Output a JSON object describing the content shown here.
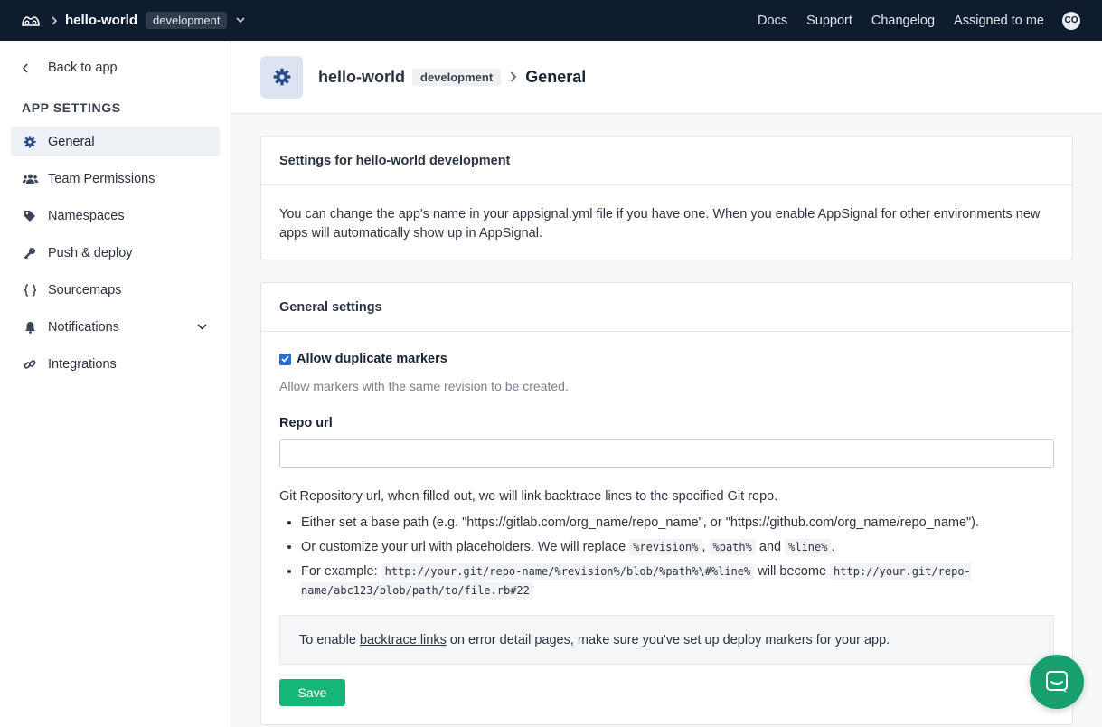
{
  "topbar": {
    "app_name": "hello-world",
    "environment": "development",
    "nav": [
      "Docs",
      "Support",
      "Changelog",
      "Assigned to me"
    ],
    "avatar_initials": "CO"
  },
  "sidebar": {
    "back_label": "Back to app",
    "section_title": "APP SETTINGS",
    "items": [
      {
        "label": "General",
        "icon": "gear-icon",
        "active": true
      },
      {
        "label": "Team Permissions",
        "icon": "users-icon"
      },
      {
        "label": "Namespaces",
        "icon": "tag-icon"
      },
      {
        "label": "Push & deploy",
        "icon": "key-icon"
      },
      {
        "label": "Sourcemaps",
        "icon": "braces-icon"
      },
      {
        "label": "Notifications",
        "icon": "bell-icon",
        "expandable": true
      },
      {
        "label": "Integrations",
        "icon": "link-icon"
      }
    ]
  },
  "header": {
    "app_name": "hello-world",
    "environment": "development",
    "title": "General"
  },
  "settings_card": {
    "title": "Settings for hello-world development",
    "body": "You can change the app's name in your appsignal.yml file if you have one. When you enable AppSignal for other environments new apps will automatically show up in AppSignal."
  },
  "general_card": {
    "title": "General settings",
    "duplicate_markers": {
      "label": "Allow duplicate markers",
      "checked": true,
      "hint": "Allow markers with the same revision to be created."
    },
    "repo_url": {
      "label": "Repo url",
      "value": "",
      "placeholder": ""
    },
    "help": {
      "intro": "Git Repository url, when filled out, we will link backtrace lines to the specified Git repo.",
      "bullet1": "Either set a base path (e.g. \"https://gitlab.com/org_name/repo_name\", or \"https://github.com/org_name/repo_name\").",
      "bullet2_prefix": "Or customize your url with placeholders. We will replace",
      "code_revision": "%revision%",
      "sep1": ",",
      "code_path": "%path%",
      "and": "and",
      "code_line": "%line%",
      "period": ".",
      "bullet3_prefix": "For example:",
      "code_example": "http://your.git/repo-name/%revision%/blob/%path%\\#%line%",
      "will_become": "will become",
      "code_result": "http://your.git/repo-name/abc123/blob/path/to/file.rb#22"
    },
    "note": {
      "prefix": "To enable",
      "link": "backtrace links",
      "suffix": "on error detail pages, make sure you've set up deploy markers for your app."
    },
    "save_label": "Save"
  },
  "colors": {
    "topbar": "#0f1b2e",
    "save": "#16b677",
    "chat": "#17a06d",
    "checkbox": "#1f6fe0"
  }
}
